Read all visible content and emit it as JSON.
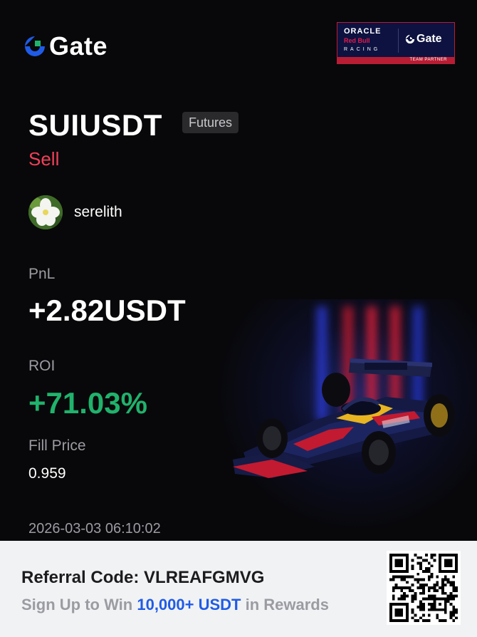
{
  "brand": {
    "logo_text": "Gate",
    "accent": "#1f5be6"
  },
  "partner_badge": {
    "line1": "ORACLE",
    "line2": "Red Bull",
    "line3": "RACING",
    "gate_text": "Gate",
    "strip_text": "TEAM PARTNER"
  },
  "trade": {
    "symbol": "SUIUSDT",
    "market_tag": "Futures",
    "side": "Sell",
    "username": "serelith",
    "pnl_label": "PnL",
    "pnl_value": "+2.82USDT",
    "roi_label": "ROI",
    "roi_value": "+71.03%",
    "fill_label": "Fill Price",
    "fill_value": "0.959",
    "timestamp": "2026-03-03 06:10:02"
  },
  "footer": {
    "referral": "Referral Code: VLREAFGMVG",
    "sign_prefix": "Sign Up to Win",
    "sign_highlight": "10,000+ USDT",
    "sign_suffix": "in Rewards"
  },
  "colors": {
    "sell": "#f0405a",
    "roi": "#20b26c",
    "background": "#08080a",
    "footer_bg": "#f1f2f4"
  },
  "icons": {
    "logo": "gate-logo-icon",
    "avatar": "flower-avatar",
    "qr": "qr-code",
    "car": "f1-car-illustration"
  }
}
